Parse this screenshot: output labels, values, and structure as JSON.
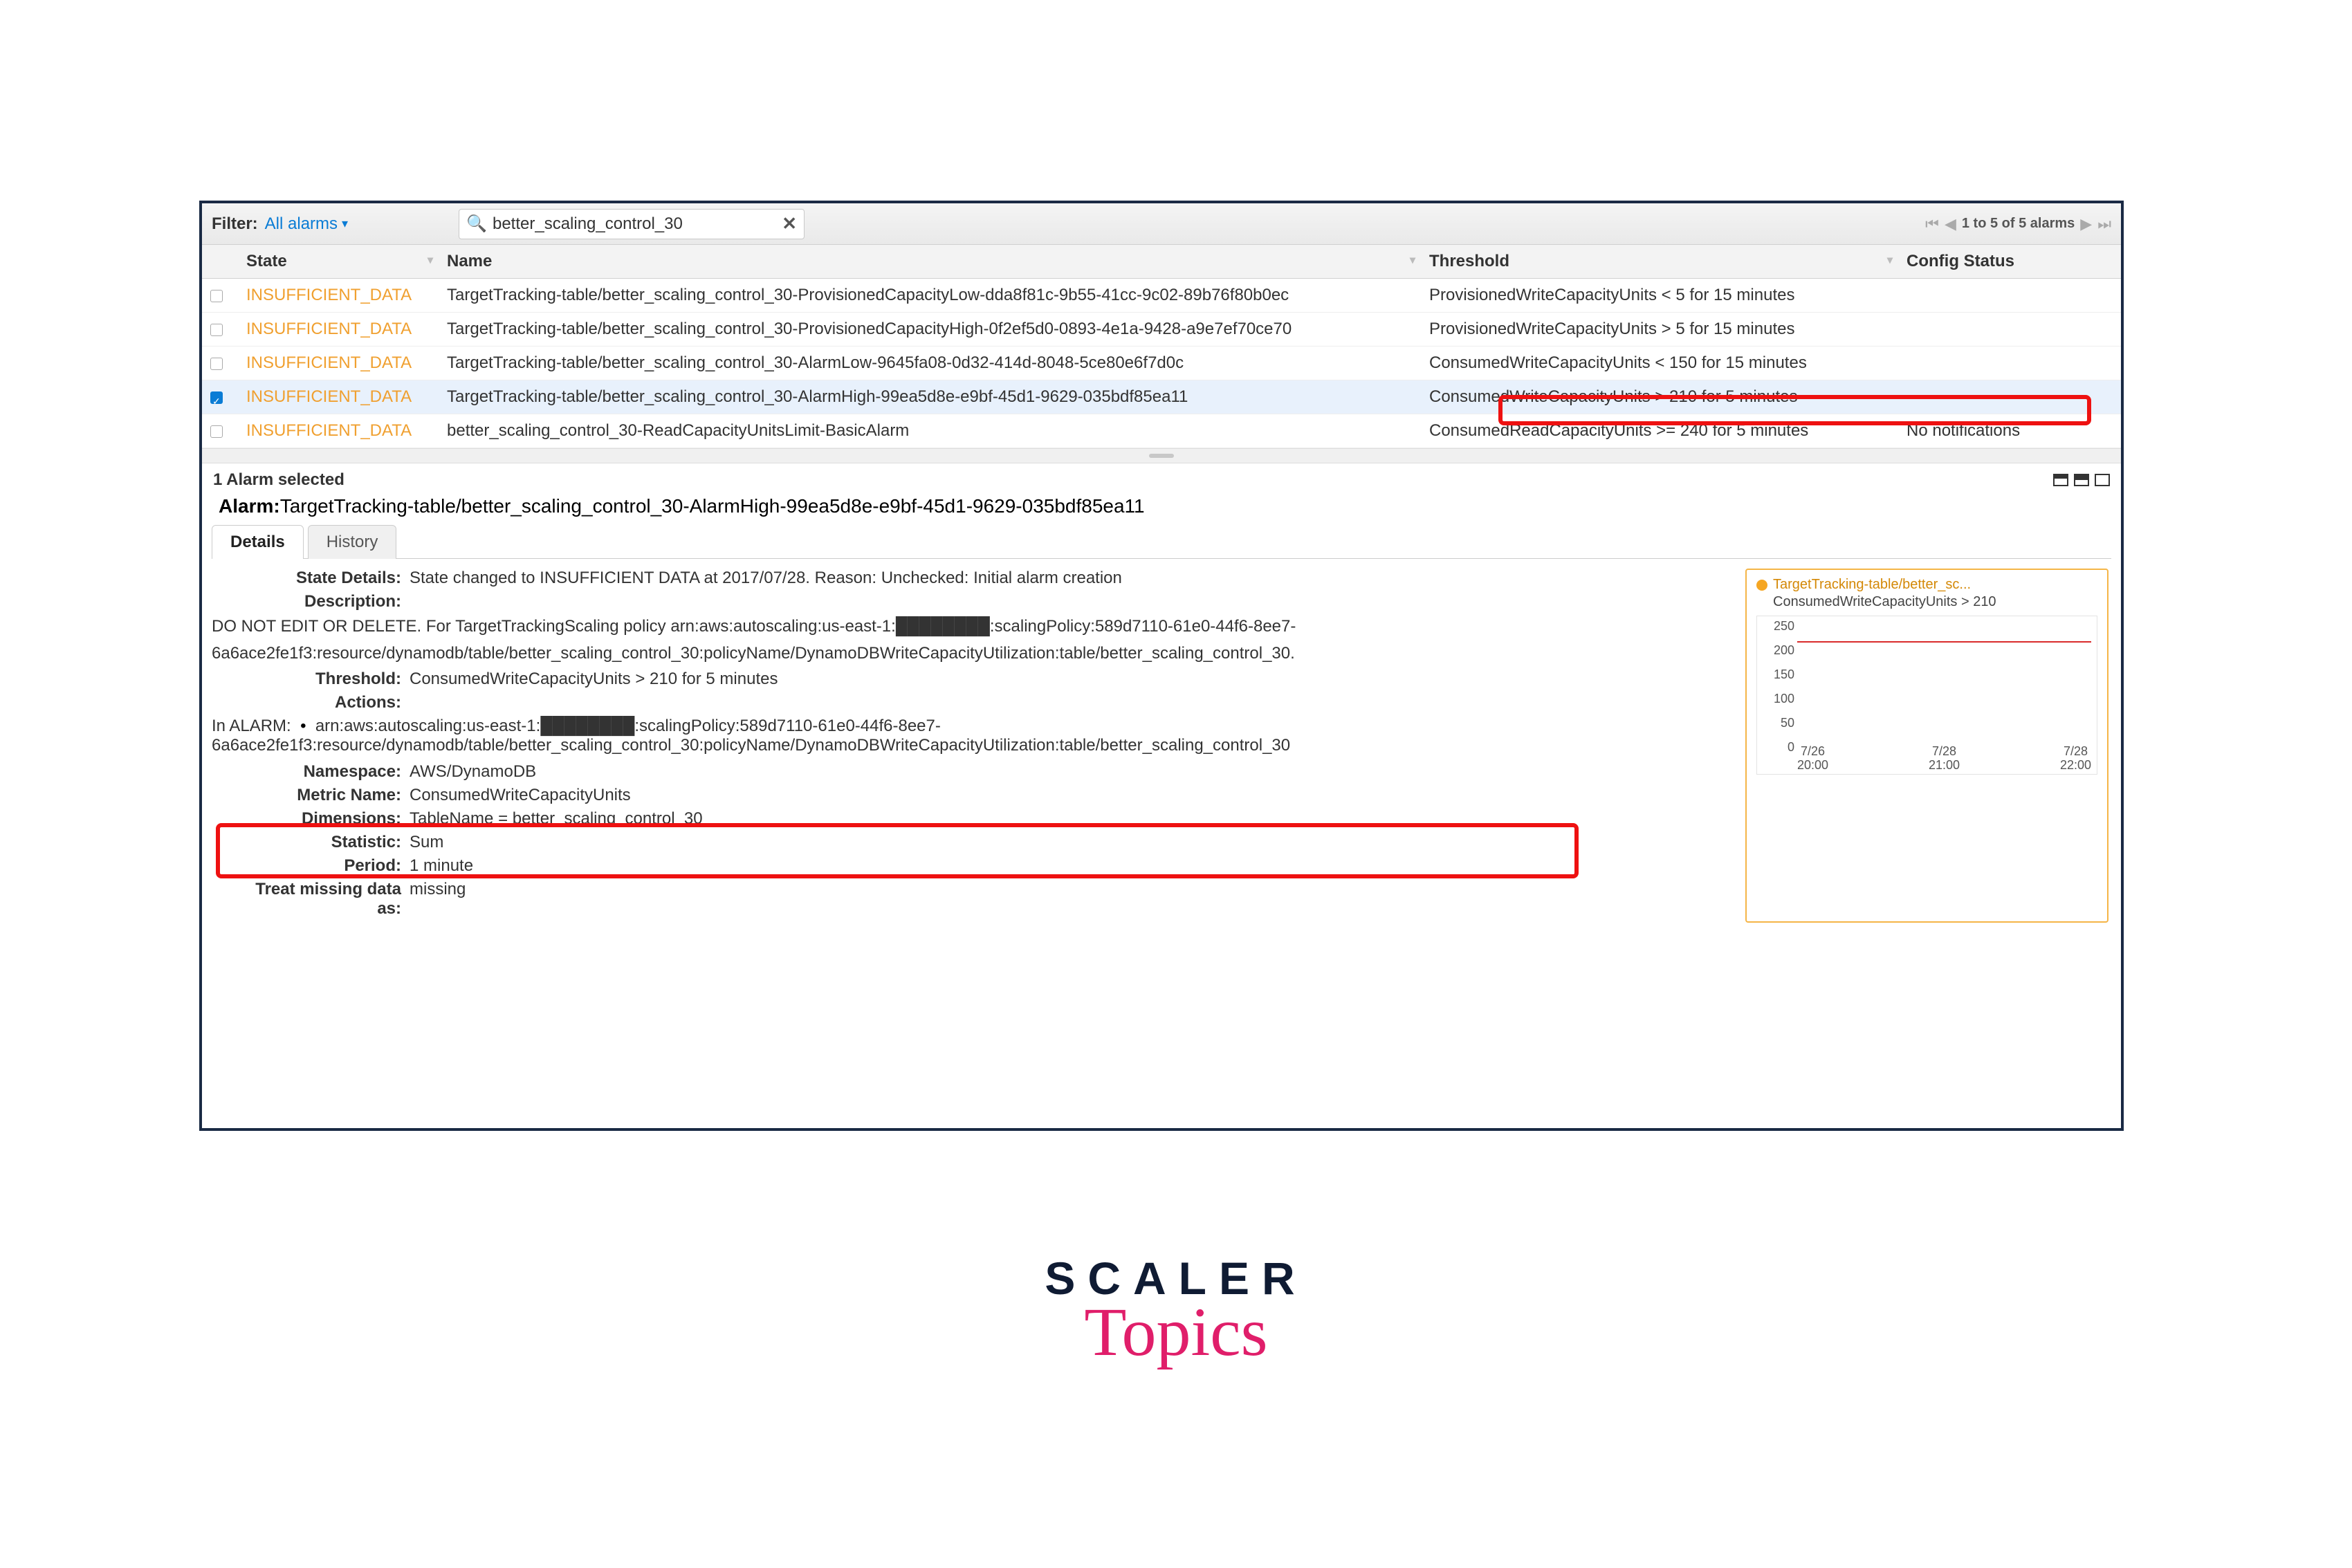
{
  "toolbar": {
    "filter_label": "Filter:",
    "filter_value": "All alarms",
    "search_value": "better_scaling_control_30",
    "pager_text": "1 to 5 of 5 alarms"
  },
  "columns": {
    "state": "State",
    "name": "Name",
    "threshold": "Threshold",
    "config_status": "Config Status"
  },
  "rows": [
    {
      "checked": false,
      "state": "INSUFFICIENT_DATA",
      "name": "TargetTracking-table/better_scaling_control_30-ProvisionedCapacityLow-dda8f81c-9b55-41cc-9c02-89b76f80b0ec",
      "threshold": "ProvisionedWriteCapacityUnits < 5 for 15 minutes",
      "config": ""
    },
    {
      "checked": false,
      "state": "INSUFFICIENT_DATA",
      "name": "TargetTracking-table/better_scaling_control_30-ProvisionedCapacityHigh-0f2ef5d0-0893-4e1a-9428-a9e7ef70ce70",
      "threshold": "ProvisionedWriteCapacityUnits > 5 for 15 minutes",
      "config": ""
    },
    {
      "checked": false,
      "state": "INSUFFICIENT_DATA",
      "name": "TargetTracking-table/better_scaling_control_30-AlarmLow-9645fa08-0d32-414d-8048-5ce80e6f7d0c",
      "threshold": "ConsumedWriteCapacityUnits < 150 for 15 minutes",
      "config": ""
    },
    {
      "checked": true,
      "state": "INSUFFICIENT_DATA",
      "name": "TargetTracking-table/better_scaling_control_30-AlarmHigh-99ea5d8e-e9bf-45d1-9629-035bdf85ea11",
      "threshold": "ConsumedWriteCapacityUnits > 210 for 5 minutes",
      "config": ""
    },
    {
      "checked": false,
      "state": "INSUFFICIENT_DATA",
      "name": "better_scaling_control_30-ReadCapacityUnitsLimit-BasicAlarm",
      "threshold": "ConsumedReadCapacityUnits >= 240 for 5 minutes",
      "config": "No notifications"
    }
  ],
  "details": {
    "selected_text": "1 Alarm selected",
    "alarm_label": "Alarm:",
    "alarm_name": "TargetTracking-table/better_scaling_control_30-AlarmHigh-99ea5d8e-e9bf-45d1-9629-035bdf85ea11",
    "tabs": {
      "details": "Details",
      "history": "History"
    },
    "state_details_label": "State Details:",
    "state_details": "State changed to INSUFFICIENT DATA at 2017/07/28. Reason: Unchecked: Initial alarm creation",
    "description_label": "Description:",
    "description_line1": "DO NOT EDIT OR DELETE. For TargetTrackingScaling policy arn:aws:autoscaling:us-east-1:████████:scalingPolicy:589d7110-61e0-44f6-8ee7-",
    "description_line2": "6a6ace2fe1f3:resource/dynamodb/table/better_scaling_control_30:policyName/DynamoDBWriteCapacityUtilization:table/better_scaling_control_30.",
    "threshold_label": "Threshold:",
    "threshold": "ConsumedWriteCapacityUnits > 210 for 5 minutes",
    "actions_label": "Actions:",
    "in_alarm_label": "In ALARM:",
    "in_alarm_bullet": "•",
    "in_alarm_line1": "arn:aws:autoscaling:us-east-1:████████:scalingPolicy:589d7110-61e0-44f6-8ee7-",
    "in_alarm_line2": "6a6ace2fe1f3:resource/dynamodb/table/better_scaling_control_30:policyName/DynamoDBWriteCapacityUtilization:table/better_scaling_control_30",
    "namespace_label": "Namespace:",
    "namespace": "AWS/DynamoDB",
    "metric_name_label": "Metric Name:",
    "metric_name": "ConsumedWriteCapacityUnits",
    "dimensions_label": "Dimensions:",
    "dimensions": "TableName = better_scaling_control_30",
    "statistic_label": "Statistic:",
    "statistic": "Sum",
    "period_label": "Period:",
    "period": "1 minute",
    "missing_label": "Treat missing data as:",
    "missing": "missing"
  },
  "chart_card": {
    "title": "TargetTracking-table/better_sc...",
    "subtitle": "ConsumedWriteCapacityUnits > 210"
  },
  "chart_data": {
    "type": "line",
    "title": "TargetTracking-table/better_sc...",
    "ylabel": "",
    "xlabel": "",
    "ylim": [
      0,
      250
    ],
    "y_ticks": [
      "250",
      "200",
      "150",
      "100",
      "50",
      "0"
    ],
    "threshold_value": 210,
    "x_ticks": [
      {
        "t1": "7/26",
        "t2": "20:00"
      },
      {
        "t1": "7/28",
        "t2": "21:00"
      },
      {
        "t1": "7/28",
        "t2": "22:00"
      }
    ],
    "series": [
      {
        "name": "ConsumedWriteCapacityUnits",
        "values": []
      }
    ]
  },
  "brand": {
    "word1": "SCALER",
    "word2": "Topics"
  }
}
